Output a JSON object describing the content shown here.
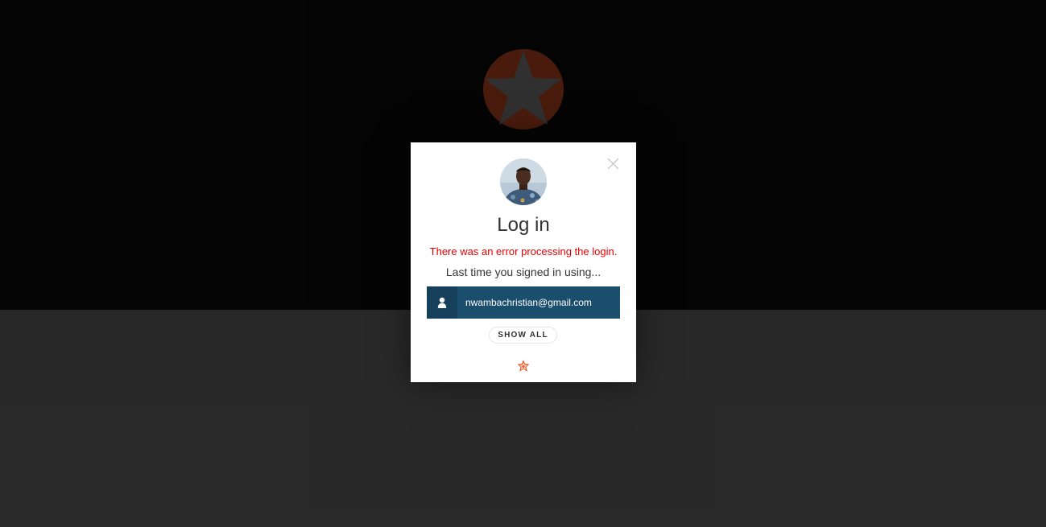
{
  "modal": {
    "title": "Log in",
    "error_message": "There was an error processing the login.",
    "subtitle": "Last time you signed in using...",
    "last_account_email": "nwambachristian@gmail.com",
    "show_all_label": "SHOW ALL"
  },
  "icons": {
    "background_logo": "auth0-star-logo",
    "close": "close-icon",
    "avatar": "user-avatar-photo",
    "account": "user-icon",
    "footer_logo": "auth0-logo"
  },
  "colors": {
    "error": "#e80000",
    "account_button": "#1b4d6d",
    "brand": "#eb5424"
  }
}
